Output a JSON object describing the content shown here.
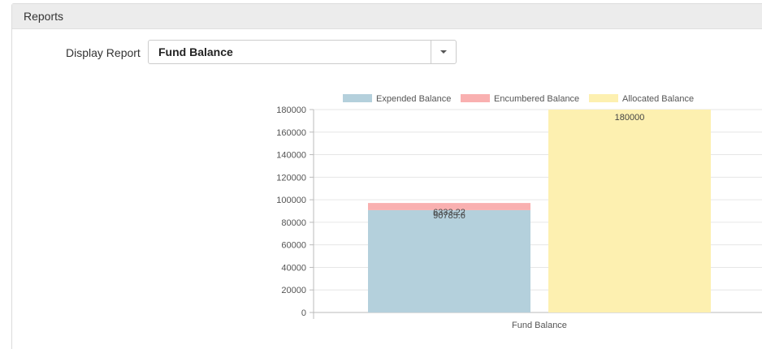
{
  "panel": {
    "title": "Reports"
  },
  "form": {
    "label": "Display Report",
    "selected": "Fund Balance",
    "caret_icon": "caret-down-icon"
  },
  "chart_data": {
    "type": "bar",
    "stacked": true,
    "categories": [
      "Fund Balance"
    ],
    "series": [
      {
        "name": "Expended Balance",
        "color": "#b4d0dc",
        "values": [
          90785.6
        ]
      },
      {
        "name": "Encumbered Balance",
        "color": "#f9b0b0",
        "values": [
          6333.22
        ]
      },
      {
        "name": "Allocated Balance",
        "color": "#fdf0b0",
        "values": [
          180000
        ]
      }
    ],
    "stack_groups": [
      [
        "Expended Balance",
        "Encumbered Balance"
      ],
      [
        "Allocated Balance"
      ]
    ],
    "yticks": [
      "0",
      "20000",
      "40000",
      "60000",
      "80000",
      "100000",
      "120000",
      "140000",
      "160000",
      "180000"
    ],
    "ylim": [
      0,
      180000
    ],
    "xlabel": "Fund Balance",
    "legend_position": "top",
    "grid": true
  }
}
